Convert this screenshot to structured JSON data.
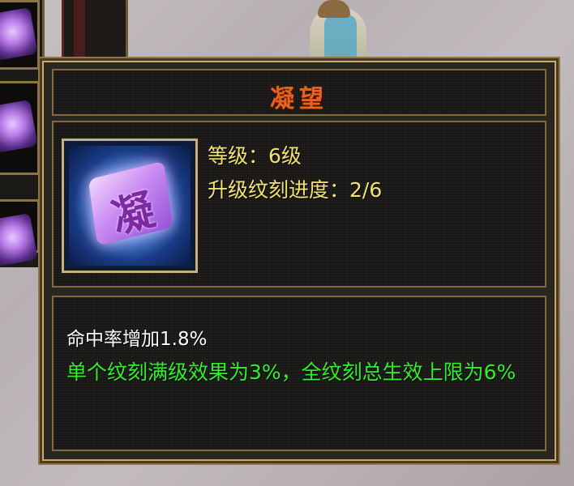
{
  "tooltip": {
    "title": "凝望",
    "item_icon": "ning-gem-icon",
    "item_icon_glyph": "凝",
    "level_text": "等级：6级",
    "progress_text": "升级纹刻进度：2/6",
    "bonus_text": "命中率增加1.8%",
    "note_text": "单个纹刻满级效果为3%，全纹刻总生效上限为6%"
  },
  "colors": {
    "title": "#e8611e",
    "info": "#f3e36c",
    "note": "#2ef12a",
    "frame": "#c7a971"
  }
}
